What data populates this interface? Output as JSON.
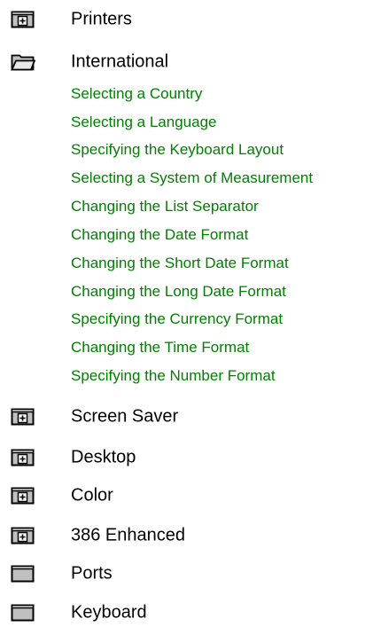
{
  "tree": {
    "nodes_before": [
      {
        "label": "Printers",
        "icon": "book-closed-plus-icon"
      },
      {
        "label": "International",
        "icon": "book-open-icon"
      }
    ],
    "topics": [
      "Selecting a Country",
      "Selecting a Language",
      "Specifying the Keyboard Layout",
      "Selecting a System of Measurement",
      "Changing the List Separator",
      "Changing the Date Format",
      "Changing the Short Date Format",
      "Changing the Long Date Format",
      "Specifying the Currency Format",
      "Changing the Time Format",
      "Specifying the Number Format"
    ],
    "nodes_after": [
      {
        "label": "Screen Saver",
        "icon": "book-closed-plus-icon"
      },
      {
        "label": "Desktop",
        "icon": "book-closed-plus-icon"
      },
      {
        "label": "Color",
        "icon": "book-closed-plus-icon"
      },
      {
        "label": "386 Enhanced",
        "icon": "book-closed-plus-icon"
      },
      {
        "label": "Ports",
        "icon": "book-closed-icon"
      },
      {
        "label": "Keyboard",
        "icon": "book-closed-icon"
      }
    ]
  },
  "colors": {
    "topic_link": "#008000",
    "text": "#000000",
    "icon_fill": "#c0c0c0",
    "icon_stroke": "#000000"
  }
}
